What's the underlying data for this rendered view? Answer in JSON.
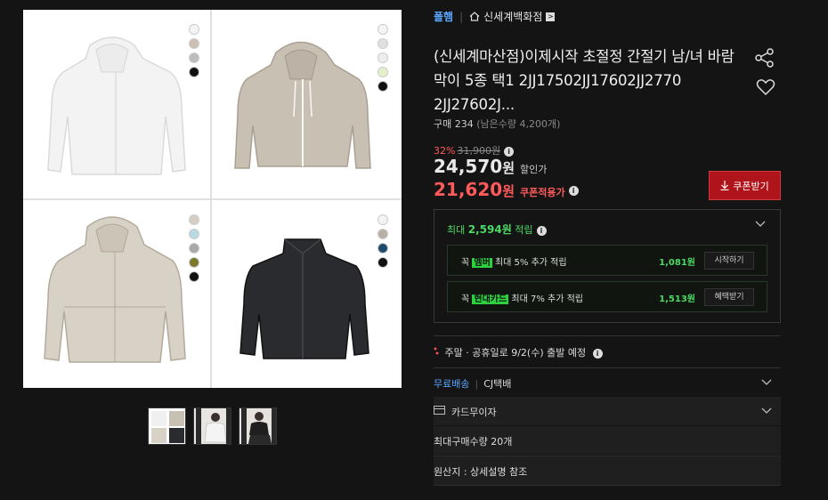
{
  "gallery": {
    "swatch_sets": [
      [
        "#f4f4f4",
        "#cdbfb2",
        "#bdbdbd",
        "#111111"
      ],
      [
        "#f4f4f4",
        "#e0e0e0",
        "#eeeeee",
        "#e3f0c8",
        "#111111"
      ],
      [
        "#d6cdc4",
        "#b9d8e2",
        "#a8a8a8",
        "#7a7a2a",
        "#111111"
      ],
      [
        "#f4f4f4",
        "#b8b0a4",
        "#1c4b6e",
        "#111111"
      ]
    ]
  },
  "breadcrumb": {
    "brand": "폴햄",
    "store": "신세계백화점",
    "arrow": ">"
  },
  "product": {
    "title": "(신세계마산점)이제시작 초절정 간절기 남/녀 바람막이 5종 택1 2JJ17502JJ17602JJ2770 2JJ27602J...",
    "buy_count": "구매 234",
    "stock": "(남은수량 4,200개)",
    "discount_pct": "32%",
    "original_price": "31,900원",
    "sale_price": "24,570",
    "sale_unit": "원",
    "sale_tag": "할인가",
    "coupon_price": "21,620",
    "coupon_unit": "원",
    "coupon_tag": "쿠폰적용가",
    "coupon_button": "쿠폰받기"
  },
  "points": {
    "prefix": "최대 ",
    "amount": "2,594원",
    "suffix": " 적립",
    "rows": [
      {
        "prefix": "꼭 ",
        "highlight": "멤버",
        "text": " 최대 5% 추가 적립",
        "amount": "1,081원",
        "button": "시작하기"
      },
      {
        "prefix": "꼭 ",
        "highlight": "현대카드",
        "text": " 최대 7% 추가 적립",
        "amount": "1,513원",
        "button": "혜택받기"
      }
    ]
  },
  "delivery": {
    "text": "주말 · 공휴일로 9/2(수) 출발 예정"
  },
  "shipping": {
    "free": "무료배송",
    "carrier": "CJ택배"
  },
  "card": {
    "label": "카드무이자"
  },
  "max_qty": "최대구매수량 20개",
  "origin": "원산지 : 상세설명 참조",
  "colors": {
    "accent_blue": "#5aa7ff",
    "accent_red": "#ff5a5a",
    "accent_green": "#4cd964",
    "button_red": "#b0141b"
  }
}
